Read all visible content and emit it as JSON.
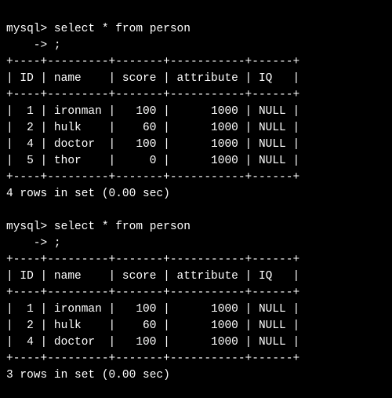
{
  "prompt": "mysql>",
  "continuation_prompt": "    ->",
  "query": "select * from person",
  "semicolon": ";",
  "border": {
    "top": "+----+---------+-------+-----------+------+",
    "head": "+----+---------+-------+-----------+------+",
    "mid": "+----+---------+-------+-----------+------+",
    "bot": "+----+---------+-------+-----------+------+"
  },
  "header": {
    "ID": "ID",
    "name": "name",
    "score": "score",
    "attribute": "attribute",
    "IQ": "IQ"
  },
  "result1": {
    "rows": [
      {
        "ID": "1",
        "name": "ironman",
        "score": "100",
        "attribute": "1000",
        "IQ": "NULL"
      },
      {
        "ID": "2",
        "name": "hulk",
        "score": "60",
        "attribute": "1000",
        "IQ": "NULL"
      },
      {
        "ID": "4",
        "name": "doctor",
        "score": "100",
        "attribute": "1000",
        "IQ": "NULL"
      },
      {
        "ID": "5",
        "name": "thor",
        "score": "0",
        "attribute": "1000",
        "IQ": "NULL"
      }
    ],
    "summary": "4 rows in set (0.00 sec)"
  },
  "result2": {
    "rows": [
      {
        "ID": "1",
        "name": "ironman",
        "score": "100",
        "attribute": "1000",
        "IQ": "NULL"
      },
      {
        "ID": "2",
        "name": "hulk",
        "score": "60",
        "attribute": "1000",
        "IQ": "NULL"
      },
      {
        "ID": "4",
        "name": "doctor",
        "score": "100",
        "attribute": "1000",
        "IQ": "NULL"
      }
    ],
    "summary": "3 rows in set (0.00 sec)"
  },
  "col_widths": {
    "ID": 4,
    "name": 9,
    "score": 7,
    "attribute": 11,
    "IQ": 6
  },
  "col_align": {
    "ID": "right",
    "name": "left",
    "score": "right",
    "attribute": "right",
    "IQ": "left"
  }
}
